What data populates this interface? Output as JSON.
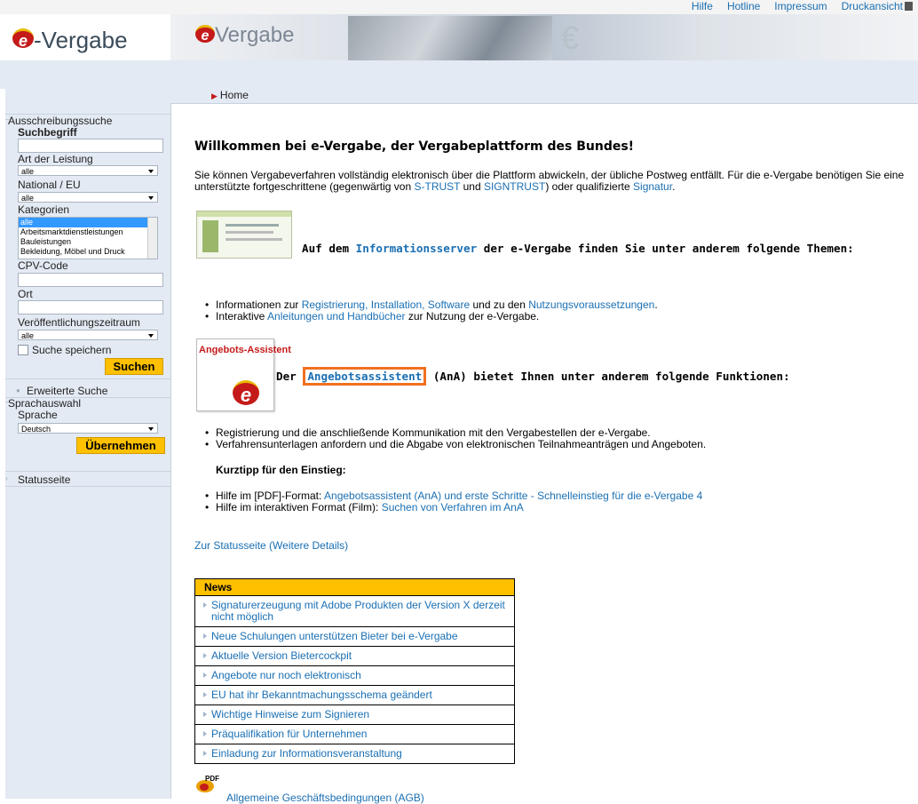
{
  "header": {
    "links": [
      "Hilfe",
      "Hotline",
      "Impressum",
      "Druckansicht"
    ],
    "logo_text": "-Vergabe",
    "banner_logo_text": "Vergabe",
    "breadcrumb": "Home"
  },
  "sidebar": {
    "search_section": "Ausschreibungssuche",
    "suchbegriff_label": "Suchbegriff",
    "suchbegriff_value": "",
    "art_label": "Art der Leistung",
    "art_value": "alle",
    "national_label": "National / EU",
    "national_value": "alle",
    "kategorien_label": "Kategorien",
    "kategorien_options": [
      "alle",
      "Arbeitsmarktdienstleistungen",
      "Bauleistungen",
      "Bekleidung, Möbel und Druck"
    ],
    "cpv_label": "CPV-Code",
    "cpv_value": "",
    "ort_label": "Ort",
    "ort_value": "",
    "zeitraum_label": "Veröffentlichungszeitraum",
    "zeitraum_value": "alle",
    "save_search_label": "Suche speichern",
    "search_button": "Suchen",
    "advanced_search": "Erweiterte Suche",
    "language_section": "Sprachauswahl",
    "language_label": "Sprache",
    "language_value": "Deutsch",
    "apply_button": "Übernehmen",
    "status_page": "Statusseite"
  },
  "main": {
    "title": "Willkommen bei e-Vergabe, der Vergabeplattform des Bundes!",
    "intro_1": "Sie können Vergabeverfahren vollständig elektronisch über die Plattform abwickeln, der übliche Postweg entfällt. Für die e-Vergabe benötigen Sie eine unterstützte fortgeschrittene (gegenwärtig von ",
    "intro_link1": "S-TRUST",
    "intro_2": " und ",
    "intro_link2": "SIGNTRUST",
    "intro_3": ") oder qualifizierte ",
    "intro_link3": "Signatur",
    "intro_4": ".",
    "info_heading_pre": "Auf dem ",
    "info_heading_link": "Informationsserver",
    "info_heading_post": " der e-Vergabe finden Sie unter anderem folgende Themen:",
    "info_b1_pre": "Informationen zur ",
    "info_b1_link1": "Registrierung, Installation, Software",
    "info_b1_mid": " und zu den ",
    "info_b1_link2": "Nutzungsvoraussetzungen",
    "info_b1_post": ".",
    "info_b2_pre": "Interaktive ",
    "info_b2_link": "Anleitungen und Handbücher",
    "info_b2_post": " zur Nutzung der e-Vergabe.",
    "ana_thumb_text": "Angebots-Assistent",
    "ana_heading_pre": "Der ",
    "ana_heading_link": "Angebotsassistent",
    "ana_heading_post": " (AnA) bietet Ihnen unter anderem folgende Funktionen:",
    "ana_b1": "Registrierung und die anschließende Kommunikation mit den Vergabestellen der e-Vergabe.",
    "ana_b2": "Verfahrensunterlagen anfordern und die Abgabe von elektronischen Teilnahmeanträgen und Angeboten.",
    "tip_heading": "Kurztipp für den Einstieg:",
    "tip_b1_pre": "Hilfe im [PDF]-Format: ",
    "tip_b1_link": "Angebotsassistent (AnA) und erste Schritte - Schnelleinstieg für die e-Vergabe 4",
    "tip_b2_pre": "Hilfe im interaktiven Format (Film): ",
    "tip_b2_link": "Suchen von Verfahren im AnA",
    "status_link": "Zur Statusseite (Weitere Details)",
    "news_title": "News",
    "news": [
      "Signaturerzeugung mit Adobe Produkten der Version X derzeit nicht möglich",
      "Neue Schulungen unterstützen Bieter bei e-Vergabe",
      "Aktuelle Version Bietercockpit",
      "Angebote nur noch elektronisch",
      "EU hat ihr Bekanntmachungsschema geändert",
      "Wichtige Hinweise zum Signieren",
      "Präqualifikation für Unternehmen",
      "Einladung zur Informationsveranstaltung"
    ],
    "pdf_icon_label": "PDF",
    "agb_link": "Allgemeine Geschäftsbedingungen (AGB)"
  }
}
